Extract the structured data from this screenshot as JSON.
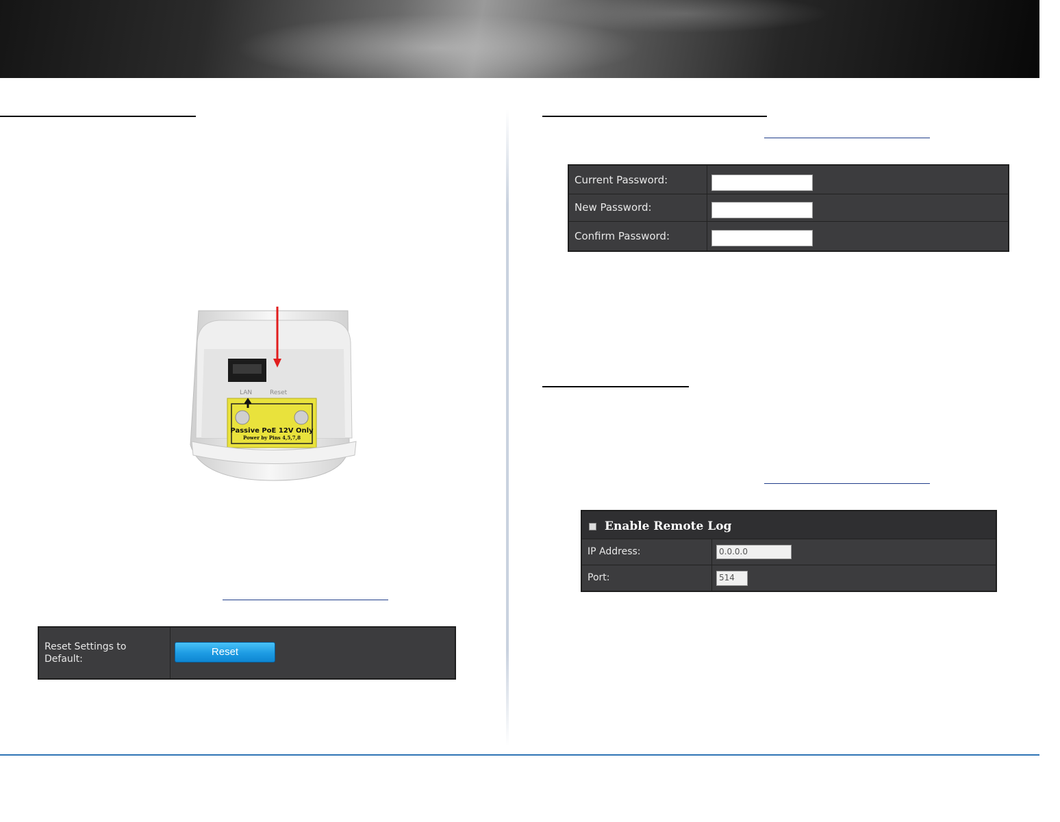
{
  "reset_panel": {
    "label": "Reset Settings to Default:",
    "button_label": "Reset"
  },
  "password_panel": {
    "rows": [
      {
        "label": "Current Password:"
      },
      {
        "label": "New Password:"
      },
      {
        "label": "Confirm Password:"
      }
    ]
  },
  "remote_log_panel": {
    "enable_label": "Enable Remote Log",
    "ip_label": "IP Address:",
    "ip_value": "0.0.0.0",
    "port_label": "Port:",
    "port_value": "514"
  },
  "device_photo": {
    "port_label": "LAN",
    "reset_label": "Reset",
    "sticker_line1": "Passive PoE 12V Only",
    "sticker_line2": "Power by Pins 4,5,7,8"
  },
  "colors": {
    "panel_bg": "#3c3c3e",
    "button_blue": "#1d9be3",
    "footer_line": "#2e74b5",
    "arrow_red": "#e11d1d",
    "sticker_yellow": "#e9e23c"
  }
}
